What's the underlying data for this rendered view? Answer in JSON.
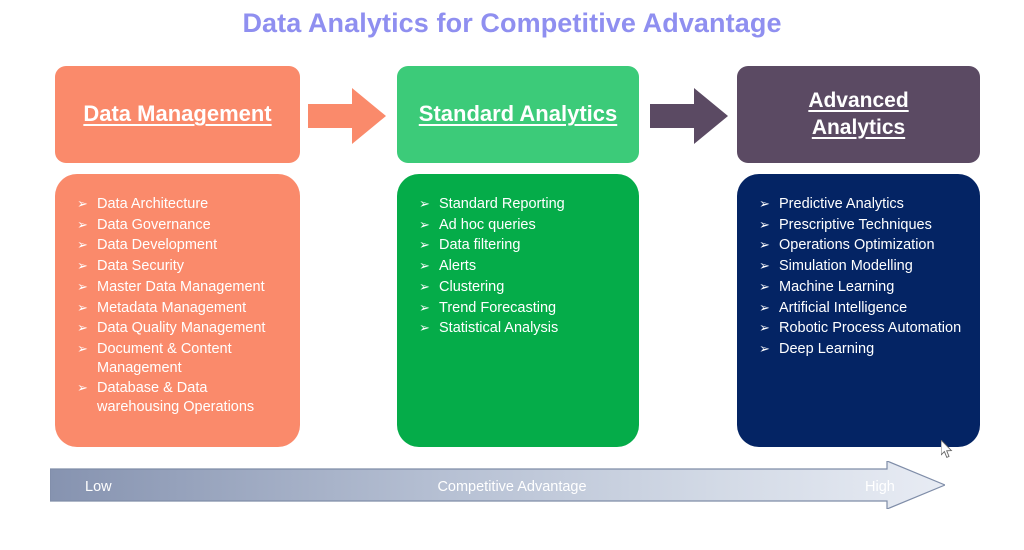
{
  "title": "Data Analytics for Competitive Advantage",
  "colors": {
    "title": "#8f8ff0",
    "column1_header": "#fa8a6b",
    "column1_body": "#fa8a6b",
    "column2_header": "#3ccb79",
    "column2_body": "#05ac49",
    "column3_header": "#5b4a63",
    "column3_body": "#042464",
    "arrow1": "#fa8a6b",
    "arrow2": "#5b4a63",
    "spectrum_start": "#8a98b4",
    "spectrum_end": "#e4e9f2",
    "spectrum_border": "#7f8da8",
    "text": "#ffffff"
  },
  "columns": [
    {
      "header": "Data Management",
      "header_lines": [
        "Data Management"
      ],
      "bullet_glyph": "➢",
      "items": [
        "Data Architecture",
        "Data Governance",
        "Data Development",
        "Data Security",
        "Master Data Management",
        "Metadata Management",
        "Data Quality Management",
        "Document & Content Management",
        "Database & Data warehousing Operations"
      ]
    },
    {
      "header": "Standard Analytics",
      "header_lines": [
        "Standard Analytics"
      ],
      "bullet_glyph": "➢",
      "items": [
        "Standard Reporting",
        "Ad hoc queries",
        "Data filtering",
        "Alerts",
        "Clustering",
        "Trend Forecasting",
        "Statistical Analysis"
      ]
    },
    {
      "header": "Advanced Analytics",
      "header_lines": [
        "Advanced",
        "Analytics"
      ],
      "bullet_glyph": "➢",
      "items": [
        "Predictive Analytics",
        "Prescriptive Techniques",
        "Operations Optimization",
        "Simulation Modelling",
        "Machine Learning",
        "Artificial Intelligence",
        "Robotic Process Automation",
        "Deep Learning"
      ]
    }
  ],
  "transition_arrows": [
    {
      "name": "arrow-column1-to-column2",
      "color": "#fa8a6b"
    },
    {
      "name": "arrow-column2-to-column3",
      "color": "#5b4a63"
    }
  ],
  "spectrum": {
    "low_label": "Low",
    "center_label": "Competitive Advantage",
    "high_label": "High",
    "direction": "left-to-right"
  }
}
